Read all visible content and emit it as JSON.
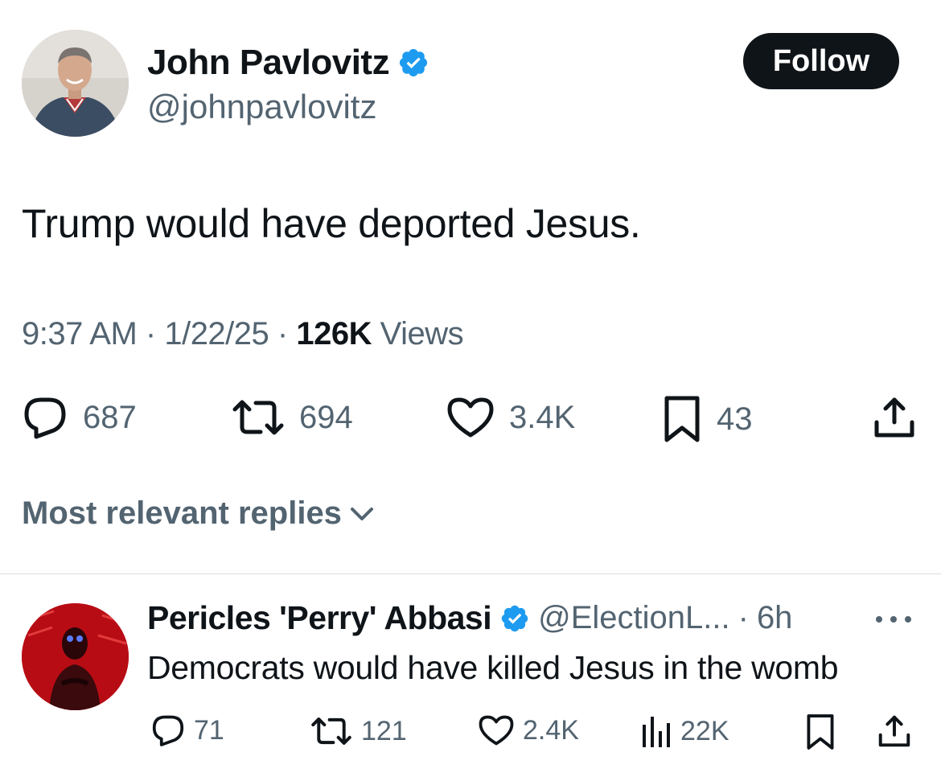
{
  "tweet": {
    "author_name": "John Pavlovitz",
    "author_handle": "@johnpavlovitz",
    "follow_label": "Follow",
    "text": "Trump would have deported Jesus.",
    "time": "9:37 AM",
    "date": "1/22/25",
    "views_count": "126K",
    "views_label": "Views",
    "actions": {
      "replies": "687",
      "reposts": "694",
      "likes": "3.4K",
      "bookmarks": "43"
    }
  },
  "replies_section": {
    "title": "Most relevant replies"
  },
  "reply": {
    "author_name": "Pericles 'Perry' Abbasi",
    "author_handle": "@ElectionL...",
    "time": "6h",
    "text": "Democrats would have killed Jesus in the womb",
    "actions": {
      "replies": "71",
      "reposts": "121",
      "likes": "2.4K",
      "views": "22K"
    }
  },
  "colors": {
    "primary_text": "#0f1419",
    "secondary_text": "#536471",
    "verified_blue": "#1d9bf0",
    "follow_bg": "#0f1419",
    "divider": "#d9dde1"
  }
}
